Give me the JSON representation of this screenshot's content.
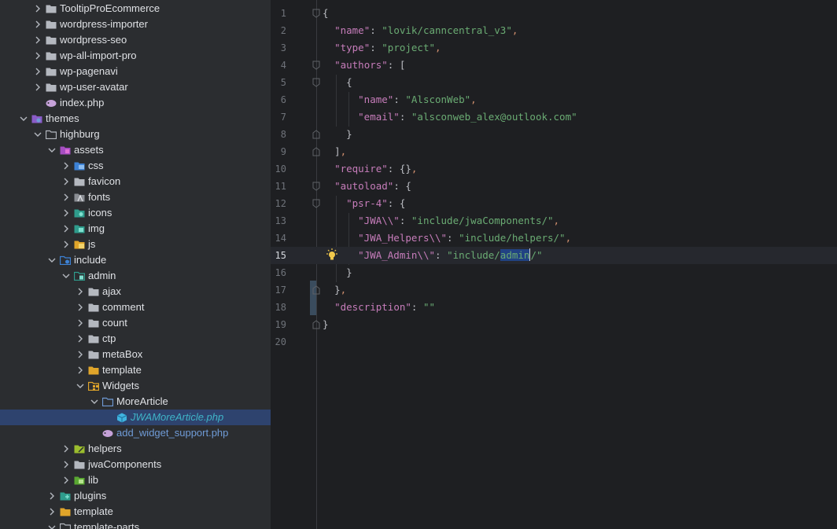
{
  "tree": {
    "items": [
      {
        "label": "TooltipProEcommerce"
      },
      {
        "label": "wordpress-importer"
      },
      {
        "label": "wordpress-seo"
      },
      {
        "label": "wp-all-import-pro"
      },
      {
        "label": "wp-pagenavi"
      },
      {
        "label": "wp-user-avatar"
      },
      {
        "label": "index.php"
      },
      {
        "label": "themes"
      },
      {
        "label": "highburg"
      },
      {
        "label": "assets"
      },
      {
        "label": "css"
      },
      {
        "label": "favicon"
      },
      {
        "label": "fonts"
      },
      {
        "label": "icons"
      },
      {
        "label": "img"
      },
      {
        "label": "js"
      },
      {
        "label": "include"
      },
      {
        "label": "admin"
      },
      {
        "label": "ajax"
      },
      {
        "label": "comment"
      },
      {
        "label": "count"
      },
      {
        "label": "ctp"
      },
      {
        "label": "metaBox"
      },
      {
        "label": "template"
      },
      {
        "label": "Widgets"
      },
      {
        "label": "MoreArticle"
      },
      {
        "label": "JWAMoreArticle.php"
      },
      {
        "label": "add_widget_support.php"
      },
      {
        "label": "helpers"
      },
      {
        "label": "jwaComponents"
      },
      {
        "label": "lib"
      },
      {
        "label": "plugins"
      },
      {
        "label": "template"
      },
      {
        "label": "template-parts"
      }
    ]
  },
  "editor": {
    "line_numbers": [
      "1",
      "2",
      "3",
      "4",
      "5",
      "6",
      "7",
      "8",
      "9",
      "10",
      "11",
      "12",
      "13",
      "14",
      "15",
      "16",
      "17",
      "18",
      "19",
      "20"
    ],
    "current_line": "15",
    "tokens": {
      "l1_brace": "{",
      "l2_key": "\"name\"",
      "l2_val": "\"lovik/canncentral_v3\"",
      "l3_key": "\"type\"",
      "l3_val": "\"project\"",
      "l4_key": "\"authors\"",
      "l4_open": "[",
      "l5_open": "{",
      "l6_key": "\"name\"",
      "l6_val": "\"AlsconWeb\"",
      "l7_key": "\"email\"",
      "l7_val": "\"alsconweb_alex@outlook.com\"",
      "l8_close": "}",
      "l9_close": "]",
      "l10_key": "\"require\"",
      "l10_val": "{}",
      "l11_key": "\"autoload\"",
      "l11_open": "{",
      "l12_key": "\"psr-4\"",
      "l12_open": "{",
      "l13_key": "\"JWA\\\\\"",
      "l13_val": "\"include/jwaComponents/\"",
      "l14_key": "\"JWA_Helpers\\\\\"",
      "l14_val": "\"include/helpers/\"",
      "l15_key": "\"JWA_Admin\\\\\"",
      "l15_val_a": "\"include/",
      "l15_val_sel": "admin",
      "l15_val_b": "/\"",
      "l16_close": "}",
      "l17_close": "}",
      "l18_key": "\"description\"",
      "l18_val": "\"\"",
      "l19_close": "}"
    }
  },
  "colors": {
    "tree_bg": "#2b2d30",
    "editor_bg": "#1e1f22",
    "json_key": "#c77dbb",
    "json_string": "#6aab73",
    "punctuation_comma": "#cf8e6d",
    "selection": "#214283"
  }
}
